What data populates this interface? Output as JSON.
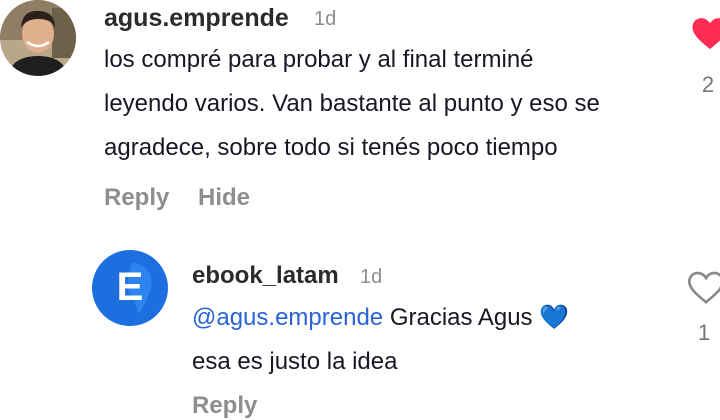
{
  "comment": {
    "username": "agus.emprende",
    "time": "1d",
    "text_lines": [
      "los compré para probar y al final terminé",
      "leyendo varios. Van bastante al punto y eso se",
      "agradece, sobre todo si tenés poco tiempo"
    ],
    "like_count": "2",
    "liked": true,
    "actions": {
      "reply": "Reply",
      "hide": "Hide"
    }
  },
  "reply": {
    "username": "ebook_latam",
    "time": "1d",
    "mention": "@agus.emprende",
    "text_line1_rest": " Gracias Agus 💙",
    "text_line2": "esa es justo la idea",
    "like_count": "1",
    "liked": false,
    "avatar_letter": "E",
    "actions": {
      "reply": "Reply"
    }
  },
  "colors": {
    "heart_active": "#fe2c55",
    "mention": "#2a63d6",
    "brand_blue": "#1d6fe0"
  },
  "icons": {
    "liked": "heart-filled-icon",
    "unliked": "heart-outline-icon"
  }
}
